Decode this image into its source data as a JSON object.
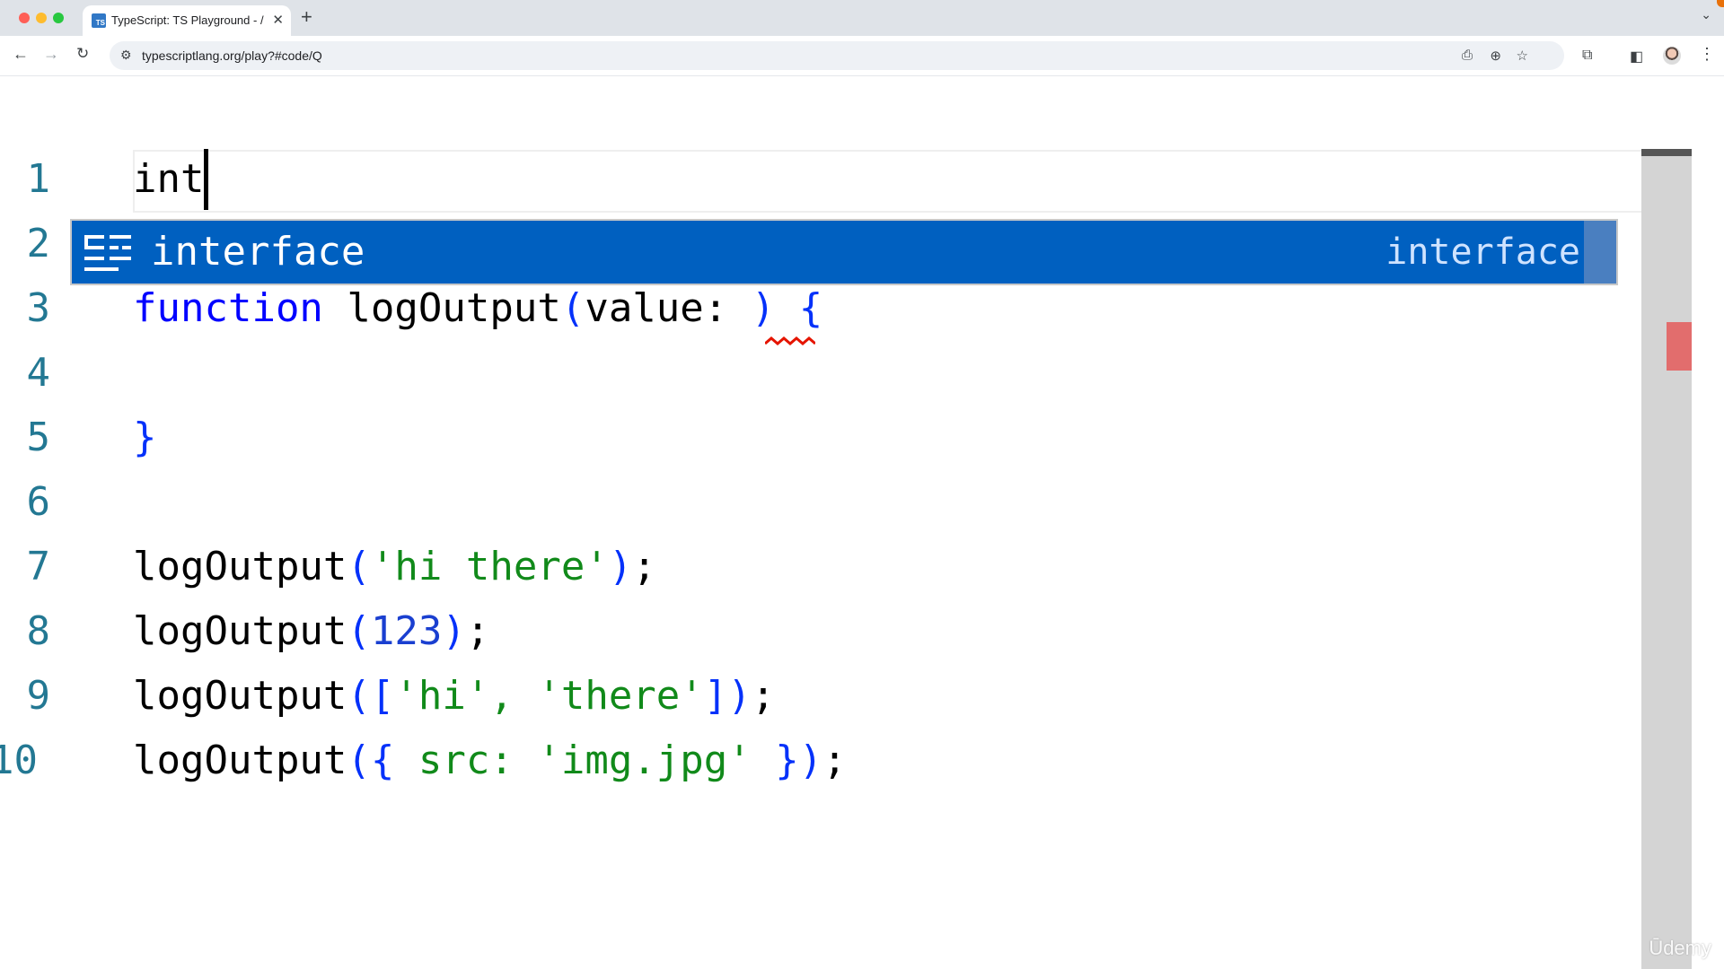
{
  "browser": {
    "tab_title": "TypeScript: TS Playground - /",
    "favicon_text": "TS",
    "url": "typescriptlang.org/play?#code/Q"
  },
  "editor": {
    "line_numbers": [
      "1",
      "2",
      "3",
      "4",
      "5",
      "6",
      "7",
      "8",
      "9",
      "10"
    ],
    "line1_text": "int",
    "line3": {
      "kw": "function",
      "fn": " logOutput",
      "open": "(",
      "param": "value: ",
      "close": ")",
      "brace": " {"
    },
    "line5_brace": "}",
    "calls": [
      {
        "fn": "logOutput",
        "open": "(",
        "arg": "'hi there'",
        "close": ")",
        "end": ";"
      },
      {
        "fn": "logOutput",
        "open": "(",
        "arg": "123",
        "close": ")",
        "end": ";"
      },
      {
        "fn": "logOutput",
        "open": "([",
        "arg": "'hi', 'there'",
        "close": "])",
        "end": ";"
      },
      {
        "fn": "logOutput",
        "open": "({",
        "arg": " src: 'img.jpg' ",
        "close": "})",
        "end": ";"
      }
    ]
  },
  "suggest": {
    "label": "interface",
    "detail": "interface",
    "icon": "snippet-icon",
    "selected_color": "#0060c0"
  },
  "watermark": "Ūdemy"
}
